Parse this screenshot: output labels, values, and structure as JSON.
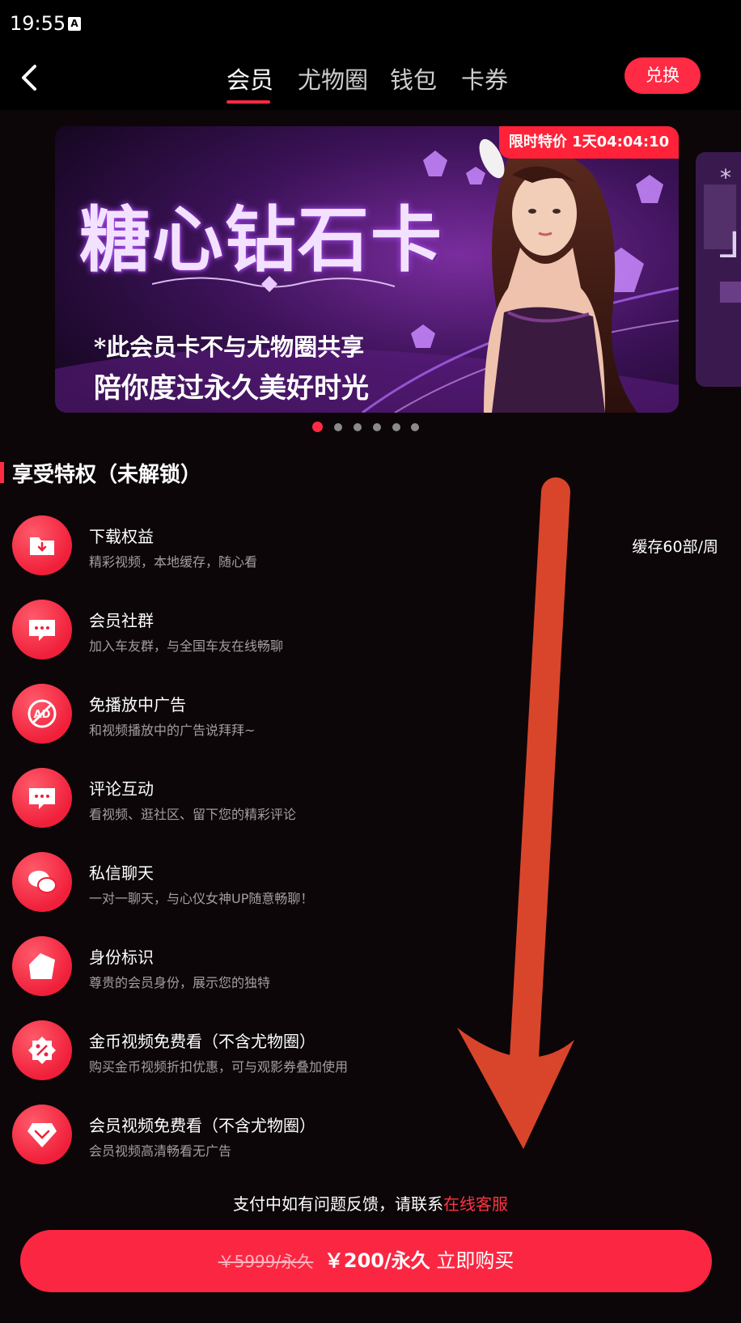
{
  "status_bar": {
    "time": "19:55",
    "indicator": "A"
  },
  "nav": {
    "tabs": [
      {
        "label": "会员",
        "active": true
      },
      {
        "label": "尤物圈",
        "active": false
      },
      {
        "label": "钱包",
        "active": false
      },
      {
        "label": "卡券",
        "active": false
      }
    ],
    "redeem_label": "兑换"
  },
  "banner": {
    "title": "糖心钻石卡",
    "line1": "*此会员卡不与尤物圈共享",
    "line2": "陪你度过永久美好时光",
    "timer": "限时特价 1天04:04:10",
    "peek_text": "*",
    "peek_char": "⅃"
  },
  "carousel": {
    "count": 6,
    "active_index": 0
  },
  "privileges": {
    "section_title": "享受特权（未解锁）",
    "items": [
      {
        "icon": "download-folder-icon",
        "title": "下载权益",
        "desc": "精彩视频，本地缓存，随心看",
        "extra": "缓存60部/周"
      },
      {
        "icon": "chat-bubble-icon",
        "title": "会员社群",
        "desc": "加入车友群，与全国车友在线畅聊",
        "extra": ""
      },
      {
        "icon": "no-ad-icon",
        "title": "免播放中广告",
        "desc": "和视频播放中的广告说拜拜~",
        "extra": ""
      },
      {
        "icon": "comment-icon",
        "title": "评论互动",
        "desc": "看视频、逛社区、留下您的精彩评论",
        "extra": ""
      },
      {
        "icon": "private-message-icon",
        "title": "私信聊天",
        "desc": "一对一聊天，与心仪女神UP随意畅聊！",
        "extra": ""
      },
      {
        "icon": "identity-badge-icon",
        "title": "身份标识",
        "desc": "尊贵的会员身份，展示您的独特",
        "extra": ""
      },
      {
        "icon": "discount-badge-icon",
        "title": "金币视频免费看（不含尤物圈）",
        "desc": "购买金币视频折扣优惠，可与观影券叠加使用",
        "extra": ""
      },
      {
        "icon": "diamond-icon",
        "title": "会员视频免费看（不含尤物圈）",
        "desc": "会员视频高清畅看无广告",
        "extra": ""
      }
    ]
  },
  "feedback": {
    "text": "支付中如有问题反馈，请联系",
    "link": "在线客服"
  },
  "buy": {
    "old_price": "￥5999/永久",
    "price": "￥200/永久",
    "action": "立即购买"
  },
  "colors": {
    "accent": "#ff2a44",
    "background": "#0c0608",
    "annotation_arrow": "#d9452b"
  }
}
